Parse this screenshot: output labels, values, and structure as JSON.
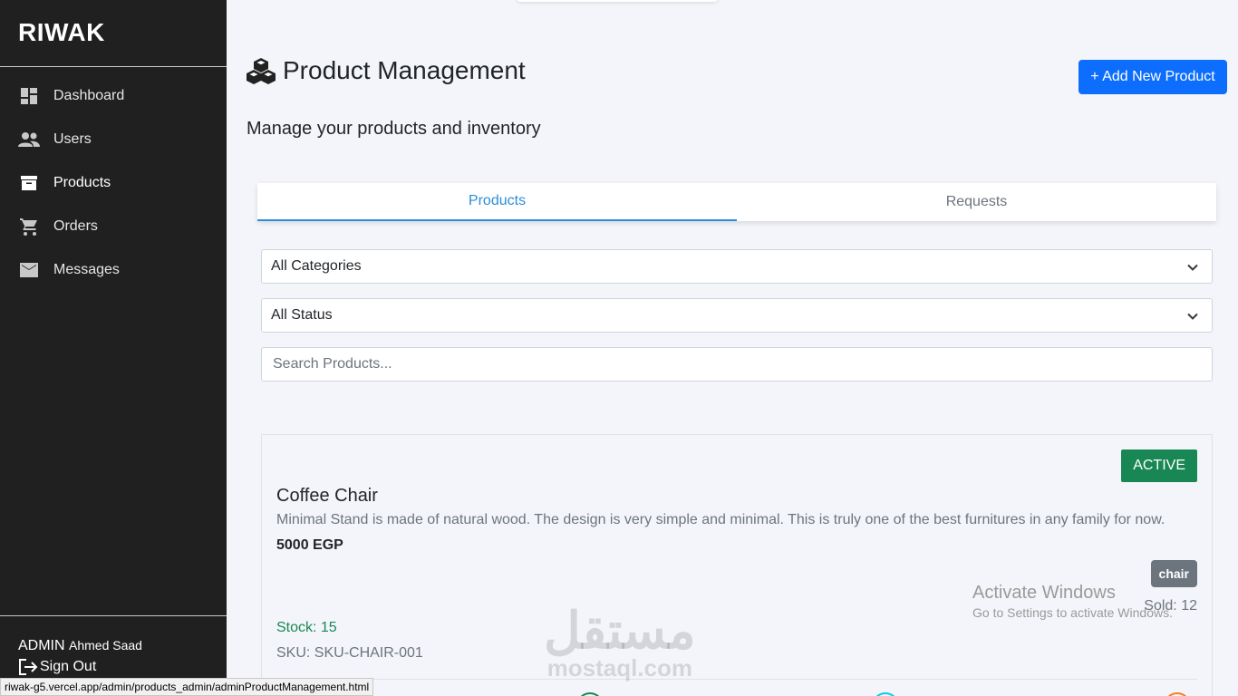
{
  "sidebar": {
    "brand": "RIWAK",
    "items": [
      {
        "label": "Dashboard",
        "icon": "dashboard-icon"
      },
      {
        "label": "Users",
        "icon": "users-icon"
      },
      {
        "label": "Products",
        "icon": "archive-box-icon",
        "active": true
      },
      {
        "label": "Orders",
        "icon": "cart-icon"
      },
      {
        "label": "Messages",
        "icon": "mail-icon"
      }
    ],
    "role": "ADMIN",
    "user_name": "Ahmed Saad",
    "signout_label": "Sign Out"
  },
  "header": {
    "title": "Product Management",
    "title_icon": "cubes-icon",
    "add_button_label": "+ Add New Product",
    "subtitle": "Manage your products and inventory"
  },
  "tabs": [
    {
      "label": "Products",
      "active": true
    },
    {
      "label": "Requests",
      "active": false
    }
  ],
  "filters": {
    "category_value": "All Categories",
    "status_value": "All Status",
    "search_placeholder": "Search Products..."
  },
  "product": {
    "status": "ACTIVE",
    "name": "Coffee Chair",
    "description": "Minimal Stand is made of natural wood. The design is very simple and minimal. This is truly one of the best furnitures in any family for now.",
    "price": "5000 EGP",
    "category": "chair",
    "sold": "Sold: 12",
    "stock": "Stock: 15",
    "sku": "SKU: SKU-CHAIR-001"
  },
  "overlays": {
    "windows_line1": "Activate Windows",
    "windows_line2": "Go to Settings to activate Windows.",
    "logo_arabic": "مستقل",
    "logo_latin": "mostaql.com"
  },
  "status_bar_url": "riwak-g5.vercel.app/admin/products_admin/adminProductManagement.html",
  "colors": {
    "sidebar_bg": "#202020",
    "primary": "#0d6efd",
    "tab_active": "#2a8fd8",
    "success": "#198754",
    "secondary": "#6c757d"
  }
}
